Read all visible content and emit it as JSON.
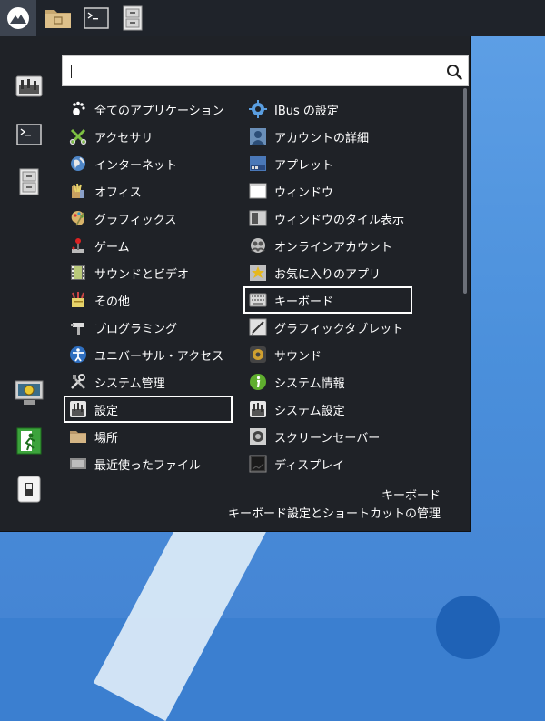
{
  "search": {
    "value": "",
    "placeholder": ""
  },
  "categories": [
    {
      "label": "全てのアプリケーション",
      "icon": "gnome-foot-icon"
    },
    {
      "label": "アクセサリ",
      "icon": "accessories-icon"
    },
    {
      "label": "インターネット",
      "icon": "globe-icon"
    },
    {
      "label": "オフィス",
      "icon": "office-icon"
    },
    {
      "label": "グラフィックス",
      "icon": "palette-icon"
    },
    {
      "label": "ゲーム",
      "icon": "joystick-icon"
    },
    {
      "label": "サウンドとビデオ",
      "icon": "film-icon"
    },
    {
      "label": "その他",
      "icon": "misc-icon"
    },
    {
      "label": "プログラミング",
      "icon": "hammer-icon"
    },
    {
      "label": "ユニバーサル・アクセス",
      "icon": "accessibility-icon"
    },
    {
      "label": "システム管理",
      "icon": "tools-icon"
    },
    {
      "label": "設定",
      "icon": "settings-icon",
      "selected": true
    },
    {
      "label": "場所",
      "icon": "folder-icon"
    },
    {
      "label": "最近使ったファイル",
      "icon": "recent-files-icon"
    }
  ],
  "apps": [
    {
      "label": "IBus の設定",
      "icon": "gear-icon"
    },
    {
      "label": "アカウントの詳細",
      "icon": "user-icon"
    },
    {
      "label": "アプレット",
      "icon": "applet-icon"
    },
    {
      "label": "ウィンドウ",
      "icon": "window-icon"
    },
    {
      "label": "ウィンドウのタイル表示",
      "icon": "tile-icon"
    },
    {
      "label": "オンラインアカウント",
      "icon": "online-accounts-icon"
    },
    {
      "label": "お気に入りのアプリ",
      "icon": "star-icon"
    },
    {
      "label": "キーボード",
      "icon": "keyboard-icon",
      "selected": true
    },
    {
      "label": "グラフィックタブレット",
      "icon": "tablet-icon"
    },
    {
      "label": "サウンド",
      "icon": "speaker-icon"
    },
    {
      "label": "システム情報",
      "icon": "info-icon"
    },
    {
      "label": "システム設定",
      "icon": "settings-icon"
    },
    {
      "label": "スクリーンセーバー",
      "icon": "screensaver-icon"
    },
    {
      "label": "ディスプレイ",
      "icon": "display-icon"
    }
  ],
  "description": {
    "title": "キーボード",
    "text": "キーボード設定とショートカットの管理"
  },
  "colors": {
    "panel": "#1f232a",
    "menu_bg": "#1f2227",
    "desktop": "#4a8fdb",
    "selection_border": "#ffffff"
  }
}
